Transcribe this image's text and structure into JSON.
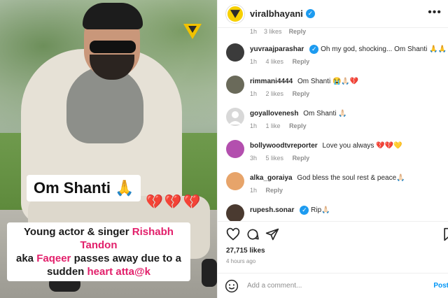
{
  "media": {
    "om_shanti": "Om Shanti",
    "om_shanti_emoji": "🙏",
    "hearts": "💔💔💔",
    "headline_line1_a": "Young actor & singer ",
    "headline_line1_b": "Rishabh Tandon",
    "headline_line2_a": "aka ",
    "headline_line2_b": "Faqeer",
    "headline_line2_c": " passes away due to a",
    "headline_line3_a": "sudden ",
    "headline_line3_b": "heart atta@k"
  },
  "header": {
    "username": "viralbhayani",
    "verified": "✓",
    "more": "•••"
  },
  "prev_comment": {
    "time": "1h",
    "likes": "3 likes",
    "reply": "Reply"
  },
  "comments": [
    {
      "user": "yuvraajparashar",
      "verified": "✓",
      "text": "Oh my god, shocking... Om Shanti 🙏🙏🙏🙏",
      "time": "1h",
      "likes": "4 likes",
      "reply": "Reply",
      "avatar_color": "#3b3b3b"
    },
    {
      "user": "rimmani4444",
      "verified": "",
      "text": "Om Shanti 😭🙏🏻💔",
      "time": "1h",
      "likes": "2 likes",
      "reply": "Reply",
      "avatar_color": "#6a6a5a"
    },
    {
      "user": "goyallovenesh",
      "verified": "",
      "text": "Om Shanti 🙏🏻",
      "time": "1h",
      "likes": "1 like",
      "reply": "Reply",
      "avatar_color": "#d8d8d8"
    },
    {
      "user": "bollywoodtvreporter",
      "verified": "",
      "text": "Love you always 💔💔💛",
      "time": "3h",
      "likes": "5 likes",
      "reply": "Reply",
      "avatar_color": "#b34fae"
    },
    {
      "user": "alka_goraiya",
      "verified": "",
      "text": "God bless the soul rest & peace🙏🏻",
      "time": "1h",
      "likes": "",
      "reply": "Reply",
      "avatar_color": "#e7a46a"
    },
    {
      "user": "rupesh.sonar",
      "verified": "✓",
      "text": "Rip🙏🏻",
      "time": "",
      "likes": "",
      "reply": "",
      "avatar_color": "#4a3a30"
    }
  ],
  "actions": {
    "likes": "27,715 likes",
    "time": "4 hours ago",
    "add_comment_placeholder": "Add a comment...",
    "post": "Post"
  },
  "colors": {
    "accent": "#0095f6",
    "verified": "#1d9bf0",
    "headline_accent": "#e2206b",
    "brand_yellow": "#f7d000"
  }
}
